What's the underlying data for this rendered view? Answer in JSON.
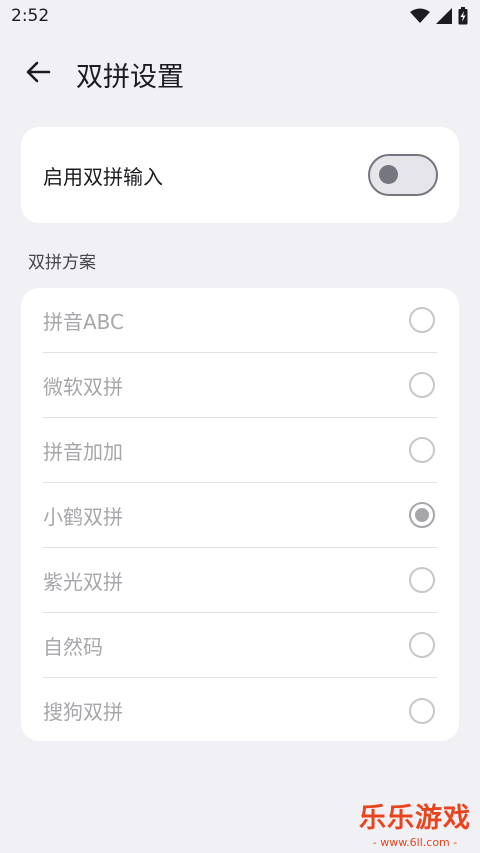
{
  "status_bar": {
    "time": "2:52",
    "icons": [
      "wifi-icon",
      "signal-icon",
      "battery-icon"
    ]
  },
  "app_bar": {
    "back_icon": "arrow-left-icon",
    "title": "双拼设置"
  },
  "toggle": {
    "label": "启用双拼输入",
    "enabled": false
  },
  "section": {
    "header": "双拼方案"
  },
  "schemes": [
    {
      "label": "拼音ABC",
      "selected": false
    },
    {
      "label": "微软双拼",
      "selected": false
    },
    {
      "label": "拼音加加",
      "selected": false
    },
    {
      "label": "小鹤双拼",
      "selected": true
    },
    {
      "label": "紫光双拼",
      "selected": false
    },
    {
      "label": "自然码",
      "selected": false
    },
    {
      "label": "搜狗双拼",
      "selected": false
    }
  ],
  "watermark": {
    "text": "乐乐游戏",
    "url": "- www.6ll.com -"
  },
  "colors": {
    "background": "#f1f1f5",
    "card": "#ffffff",
    "disabled_text": "#a7a7ab",
    "watermark": "#e8451e"
  }
}
